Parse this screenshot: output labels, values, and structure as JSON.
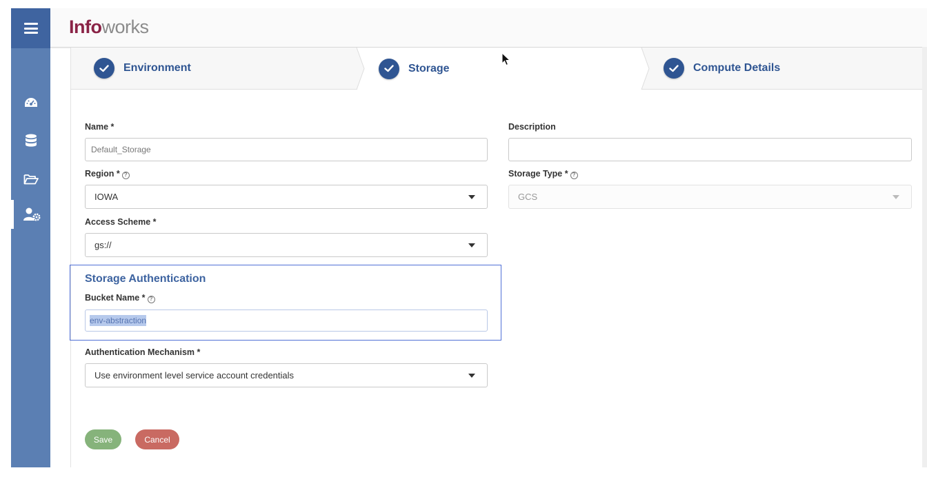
{
  "app": {
    "logo_part1": "Info",
    "logo_part2": "works"
  },
  "sidebar": {
    "items": [
      {
        "icon": "dashboard-icon"
      },
      {
        "icon": "database-icon"
      },
      {
        "icon": "folder-open-icon"
      },
      {
        "icon": "user-settings-icon",
        "active": true
      }
    ]
  },
  "steps": [
    {
      "label": "Environment",
      "completed": true
    },
    {
      "label": "Storage",
      "completed": true,
      "current": true
    },
    {
      "label": "Compute Details",
      "completed": true
    }
  ],
  "form": {
    "name_label": "Name *",
    "name_value": "Default_Storage",
    "description_label": "Description",
    "description_value": "",
    "region_label": "Region *",
    "region_value": "IOWA",
    "storage_type_label": "Storage Type *",
    "storage_type_value": "GCS",
    "access_scheme_label": "Access Scheme *",
    "access_scheme_value": "gs://",
    "storage_auth_title": "Storage Authentication",
    "bucket_label": "Bucket Name *",
    "bucket_value": "env-abstraction",
    "auth_mech_label": "Authentication Mechanism *",
    "auth_mech_value": "Use environment level service account credentials",
    "help_glyph": "?"
  },
  "actions": {
    "save_label": "Save",
    "cancel_label": "Cancel"
  },
  "colors": {
    "brand": "#8a2346",
    "primary": "#2f5592",
    "sidebar": "#5b7fb3",
    "save": "#86b37b",
    "cancel": "#c96a62"
  }
}
